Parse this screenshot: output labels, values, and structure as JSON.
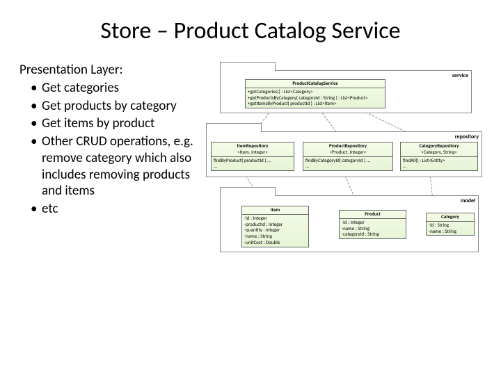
{
  "title": "Store – Product Catalog Service",
  "left": {
    "heading": "Presentation Layer:",
    "bullets": [
      "Get categories",
      "Get products by category",
      "Get items by product",
      "Other CRUD operations, e.g. remove category which also includes removing products and items",
      "etc"
    ]
  },
  "diagram": {
    "packages": {
      "service": "service",
      "repository": "repository",
      "model": "model"
    },
    "classes": {
      "service": {
        "name": "ProductCatalogService",
        "ops": [
          "+getCategories() : List<Category>",
          "+getProductsByCategory( categoryId : String ) : List<Product>",
          "+getItemsByProduct( productId ) : List<Item>"
        ]
      },
      "itemRepo": {
        "name": "ItemRepository",
        "stereo": "<Item, Integer>",
        "ops": [
          "findByProduct( productId ) ...",
          "..."
        ]
      },
      "productRepo": {
        "name": "ProductRepository",
        "stereo": "<Product, Integer>",
        "ops": [
          "findByCategoryId( categoryId ) ...",
          "..."
        ]
      },
      "categoryRepo": {
        "name": "CategoryRepository",
        "stereo": "<Category, String>",
        "ops": [
          "findAll() : List<Entity>",
          "..."
        ]
      },
      "item": {
        "name": "Item",
        "attrs": [
          "-id : Integer",
          "-productId : Integer",
          "-quantity : Integer",
          "-name : String",
          "-unitCost : Double"
        ]
      },
      "product": {
        "name": "Product",
        "attrs": [
          "-id : Integer",
          "-name : String",
          "-categoryId : String"
        ]
      },
      "category": {
        "name": "Category",
        "attrs": [
          "-id : String",
          "-name : String"
        ]
      }
    }
  }
}
